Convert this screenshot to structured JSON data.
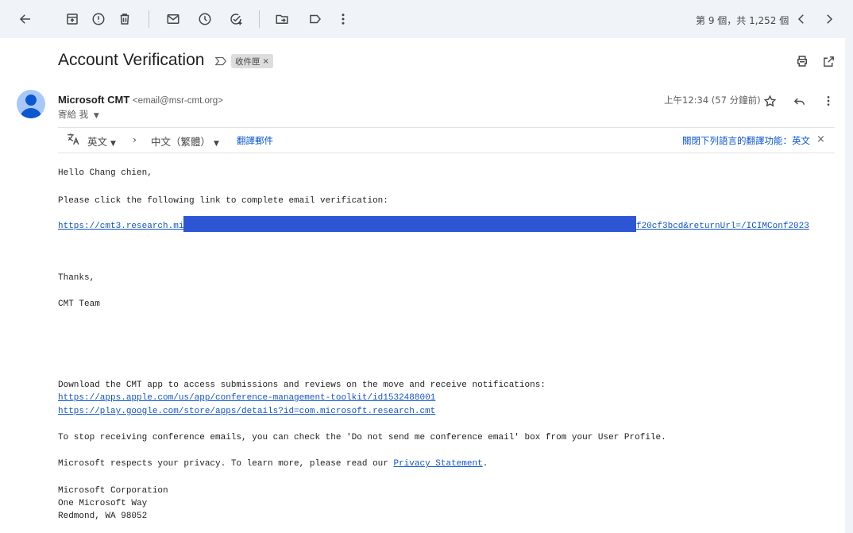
{
  "toolbar": {
    "pager": "第 9 個，共 1,252 個",
    "buttons": [
      "back",
      "archive",
      "report-spam",
      "delete",
      "mark-unread",
      "snooze",
      "add-to-tasks",
      "move-to",
      "label",
      "more",
      "newer",
      "older"
    ]
  },
  "email": {
    "subject": "Account Verification",
    "label_chip": "收件匣",
    "label_chip_remove": "×",
    "sender_name": "Microsoft CMT",
    "sender_email": "<email@msr-cmt.org>",
    "to": "寄給 我",
    "time": "上午12:34 (57 分鐘前)"
  },
  "translate": {
    "from_lang": "英文",
    "arrow": "›",
    "to_lang": "中文（繁體）",
    "translate_link": "翻譯郵件",
    "turn_off": "關閉下列語言的翻譯功能：英文",
    "close": "×"
  },
  "body": {
    "greeting": "Hello Chang chien,",
    "instruction": "Please click the following link to complete email verification:",
    "link_start": "https://cmt3.research.mi",
    "link_end": "f20cf3bcd&returnUrl=/ICIMConf2023",
    "thanks": "Thanks,",
    "team": "CMT Team",
    "app_text": "Download the CMT app to access submissions and reviews on the move and receive notifications:",
    "app_link_apple": "https://apps.apple.com/us/app/conference-management-toolkit/id1532488001",
    "app_link_google": "https://play.google.com/store/apps/details?id=com.microsoft.research.cmt",
    "stop_text": "To stop receiving conference emails, you can check the 'Do not send me conference email' box from your User Profile.",
    "privacy_prefix": "Microsoft respects your privacy. To learn more, please read our ",
    "privacy_link": "Privacy Statement",
    "privacy_suffix": ".",
    "address_line1": "Microsoft Corporation",
    "address_line2": "One Microsoft Way",
    "address_line3": "Redmond, WA 98052"
  }
}
